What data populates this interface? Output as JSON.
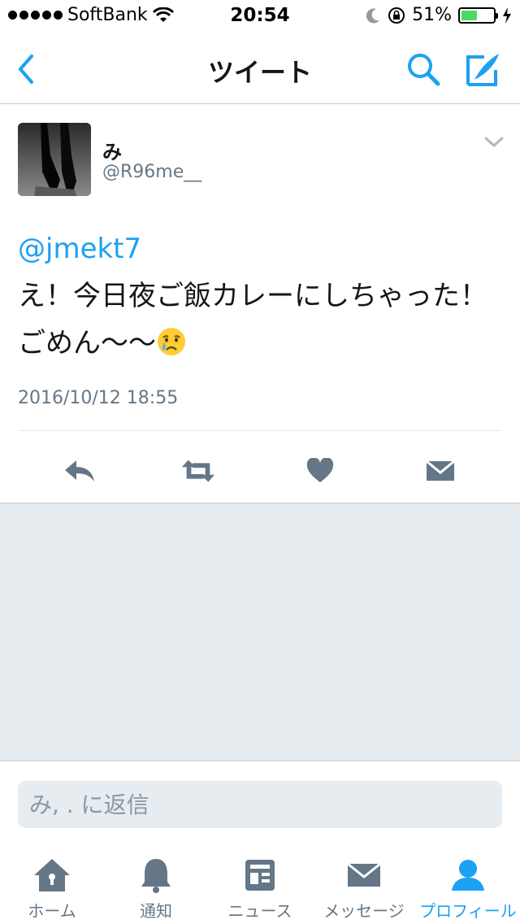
{
  "status_bar": {
    "carrier": "SoftBank",
    "time": "20:54",
    "battery": "51%"
  },
  "navbar": {
    "title": "ツイート"
  },
  "tweet": {
    "name": "み",
    "handle": "@R96me__",
    "mention": "@jmekt7",
    "text": "え！今日夜ご飯カレーにしちゃった！ごめん〜〜",
    "timestamp": "2016/10/12 18:55"
  },
  "reply": {
    "placeholder": "み, . に返信"
  },
  "tabs": [
    {
      "label": "ホーム",
      "icon": "home-icon"
    },
    {
      "label": "通知",
      "icon": "bell-icon"
    },
    {
      "label": "ニュース",
      "icon": "news-icon"
    },
    {
      "label": "メッセージ",
      "icon": "envelope-icon"
    },
    {
      "label": "プロフィール",
      "icon": "person-icon",
      "active": true
    }
  ],
  "colors": {
    "accent": "#1da1f2",
    "icon_gray": "#657786",
    "background_gray": "#e6ecf0",
    "battery_green": "#4cd964"
  }
}
